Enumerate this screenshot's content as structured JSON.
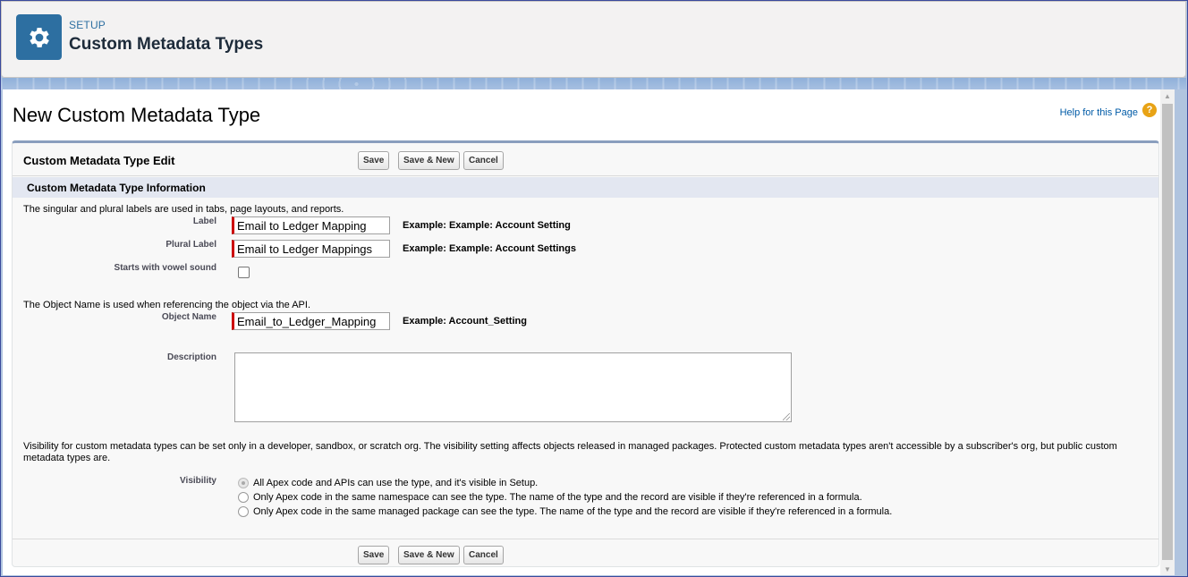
{
  "header": {
    "eyebrow": "SETUP",
    "title": "Custom Metadata Types",
    "icon": "gear-icon",
    "icon_bg": "#2d6fa1"
  },
  "page": {
    "title": "New Custom Metadata Type",
    "help_link": "Help for this Page",
    "help_icon_glyph": "?"
  },
  "panel": {
    "title": "Custom Metadata Type Edit",
    "buttons": {
      "save": "Save",
      "save_new": "Save & New",
      "cancel": "Cancel"
    }
  },
  "section": {
    "title": "Custom Metadata Type Information",
    "labels_help": "The singular and plural labels are used in tabs, page layouts, and reports.",
    "object_help": "The Object Name is used when referencing the object via the API.",
    "visibility_note": "Visibility for custom metadata types can be set only in a developer, sandbox, or scratch org. The visibility setting affects objects released in managed packages. Protected custom metadata types aren't accessible by a subscriber's org, but public custom metadata types are."
  },
  "fields": {
    "label": {
      "label": "Label",
      "value": "Email to Ledger Mapping",
      "example": "Example:  Example: Account Setting"
    },
    "plural_label": {
      "label": "Plural Label",
      "value": "Email to Ledger Mappings",
      "example": "Example:  Example: Account Settings"
    },
    "vowel": {
      "label": "Starts with vowel sound",
      "checked": false
    },
    "object_name": {
      "label": "Object Name",
      "value": "Email_to_Ledger_Mapping",
      "example": "Example:  Account_Setting"
    },
    "description": {
      "label": "Description",
      "value": ""
    },
    "visibility": {
      "label": "Visibility",
      "options": [
        "All Apex code and APIs can use the type, and it's visible in Setup.",
        "Only Apex code in the same namespace can see the type. The name of the type and the record are visible if they're referenced in a formula.",
        "Only Apex code in the same managed package can see the type. The name of the type and the record are visible if they're referenced in a formula."
      ],
      "selected_index": 0
    }
  },
  "colors": {
    "required_bar": "#cc0000",
    "link": "#015ba7",
    "section_header_bg": "#e3e7f1"
  }
}
